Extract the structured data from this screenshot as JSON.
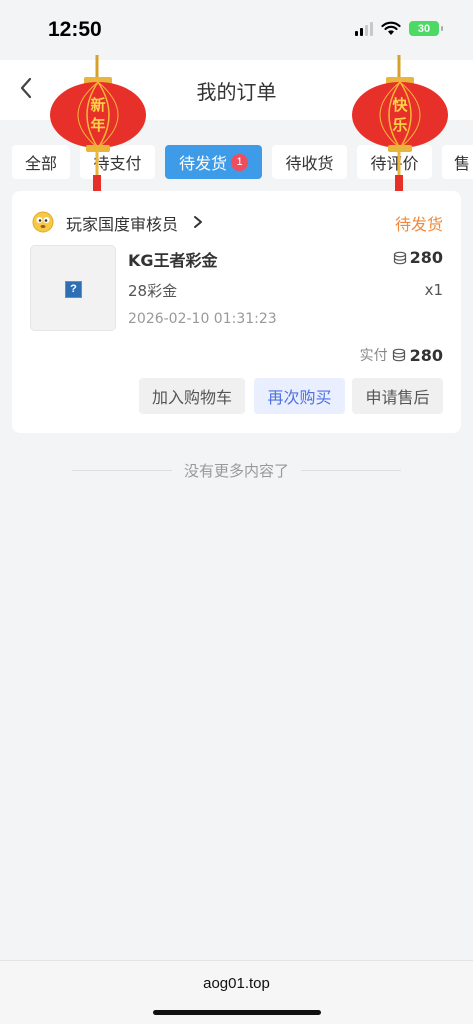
{
  "status_bar": {
    "time": "12:50",
    "battery": "30"
  },
  "header": {
    "title": "我的订单"
  },
  "decorations": {
    "lantern_left": [
      "新",
      "年"
    ],
    "lantern_right": [
      "快",
      "乐"
    ]
  },
  "tabs": [
    {
      "label": "全部"
    },
    {
      "label": "待支付"
    },
    {
      "label": "待发货",
      "badge": "1",
      "active": true
    },
    {
      "label": "待收货"
    },
    {
      "label": "待评价"
    },
    {
      "label": "售"
    }
  ],
  "order": {
    "shop_name": "玩家国度审核员",
    "status": "待发货",
    "status_color": "#f0883e",
    "product": {
      "name": "KG王者彩金",
      "spec": "28彩金",
      "time": "2026-02-10 01:31:23",
      "price": "280",
      "qty": "x1"
    },
    "paid_label": "实付",
    "paid_value": "280",
    "buttons": {
      "add_cart": "加入购物车",
      "rebuy": "再次购买",
      "after_sale": "申请售后"
    }
  },
  "list_end_text": "没有更多内容了",
  "browser": {
    "url": "aog01.top"
  },
  "colors": {
    "accent": "#3d9be8",
    "badge": "#ef4d5e",
    "rebuy_text": "#4f72e0"
  }
}
